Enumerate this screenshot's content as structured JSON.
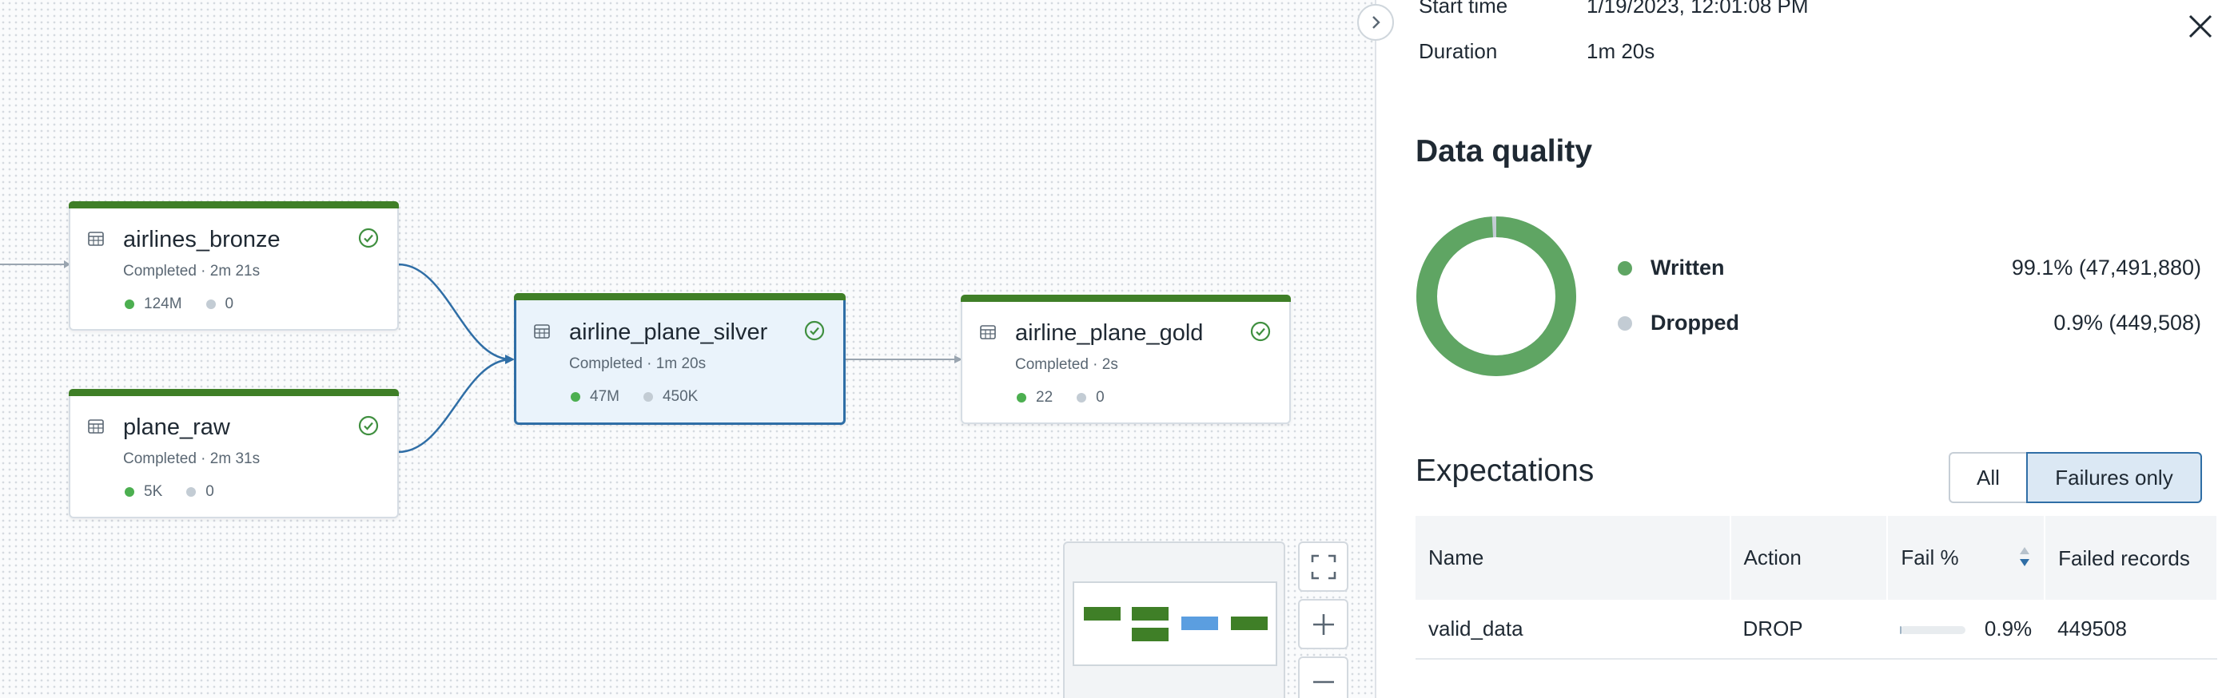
{
  "graph": {
    "nodes": [
      {
        "id": "airlines_bronze",
        "title": "airlines_bronze",
        "subtitle": "Completed · 2m 21s",
        "written": "124M",
        "dropped": "0"
      },
      {
        "id": "plane_raw",
        "title": "plane_raw",
        "subtitle": "Completed · 2m 31s",
        "written": "5K",
        "dropped": "0"
      },
      {
        "id": "airline_plane_silver",
        "title": "airline_plane_silver",
        "subtitle": "Completed · 1m 20s",
        "written": "47M",
        "dropped": "450K"
      },
      {
        "id": "airline_plane_gold",
        "title": "airline_plane_gold",
        "subtitle": "Completed · 2s",
        "written": "22",
        "dropped": "0"
      }
    ],
    "colors": {
      "completed_bar": "#3f7f27",
      "written": "#4caf50",
      "dropped": "#c3ccd4",
      "selected_border": "#2f6ea6",
      "edge": "#2f6ea6"
    }
  },
  "controls": {
    "collapse_icon": "chevron-right-icon",
    "fit_icon": "fit-view-icon",
    "zoom_in_icon": "plus-icon",
    "zoom_out_icon": "minus-icon"
  },
  "panel": {
    "start_time_label": "Start time",
    "start_time_value": "1/19/2023, 12:01:08 PM",
    "duration_label": "Duration",
    "duration_value": "1m 20s",
    "close_icon": "close-icon",
    "data_quality": {
      "title": "Data quality",
      "written_label": "Written",
      "written_value": "99.1% (47,491,880)",
      "written_fraction": 0.991,
      "dropped_label": "Dropped",
      "dropped_value": "0.9% (449,508)",
      "dropped_fraction": 0.009,
      "written_color": "#5fa563",
      "dropped_color": "#c3ccd4"
    },
    "expectations": {
      "title": "Expectations",
      "filter_all": "All",
      "filter_failures": "Failures only",
      "columns": [
        "Name",
        "Action",
        "Fail %",
        "Failed records"
      ],
      "rows": [
        {
          "name": "valid_data",
          "action": "DROP",
          "fail_pct": "0.9%",
          "fail_fraction": 0.009,
          "failed_records": "449508"
        }
      ]
    }
  }
}
